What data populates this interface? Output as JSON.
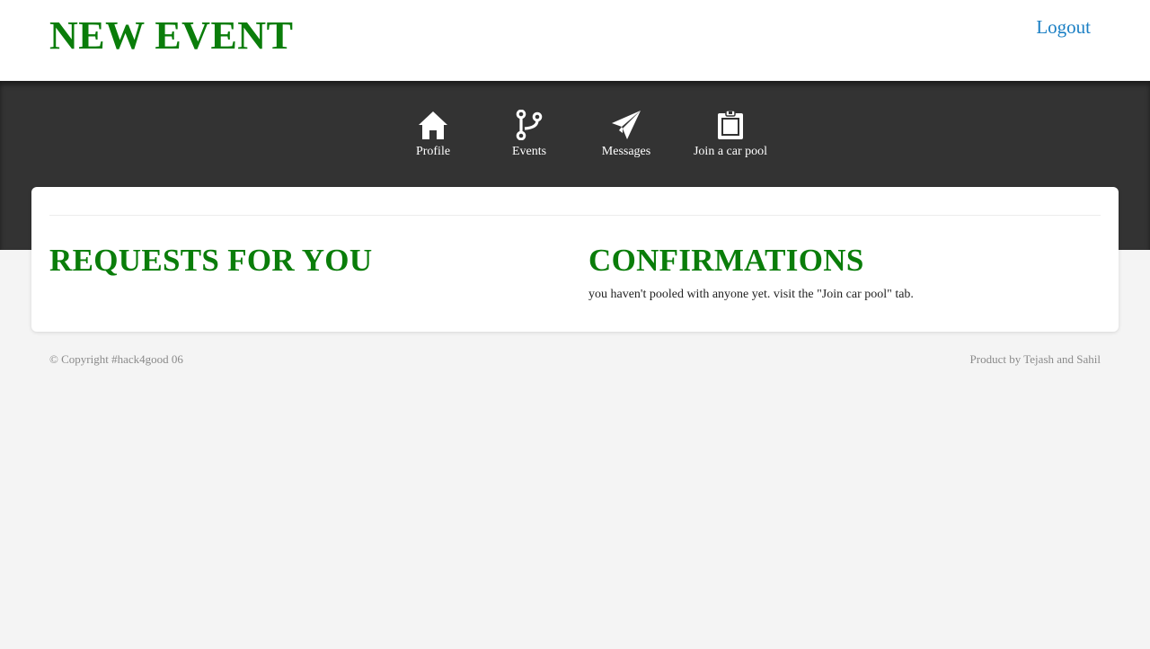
{
  "header": {
    "title": "NEW EVENT",
    "logout_label": "Logout"
  },
  "nav": {
    "items": [
      {
        "label": "Profile",
        "icon": "home-icon"
      },
      {
        "label": "Events",
        "icon": "branch-icon"
      },
      {
        "label": "Messages",
        "icon": "paper-plane-icon"
      },
      {
        "label": "Join a car pool",
        "icon": "clipboard-icon"
      }
    ]
  },
  "main": {
    "requests_title": "REQUESTS FOR YOU",
    "confirmations_title": "CONFIRMATIONS",
    "confirmations_text": "you haven't pooled with anyone yet. visit the \"Join car pool\" tab."
  },
  "footer": {
    "copyright": "© Copyright #hack4good 06",
    "credit": "Product by Tejash and Sahil"
  },
  "colors": {
    "title_green": "#0a7d0a",
    "link_blue": "#1a7fc4",
    "nav_bg": "#333333",
    "page_bg": "#f4f4f4"
  }
}
